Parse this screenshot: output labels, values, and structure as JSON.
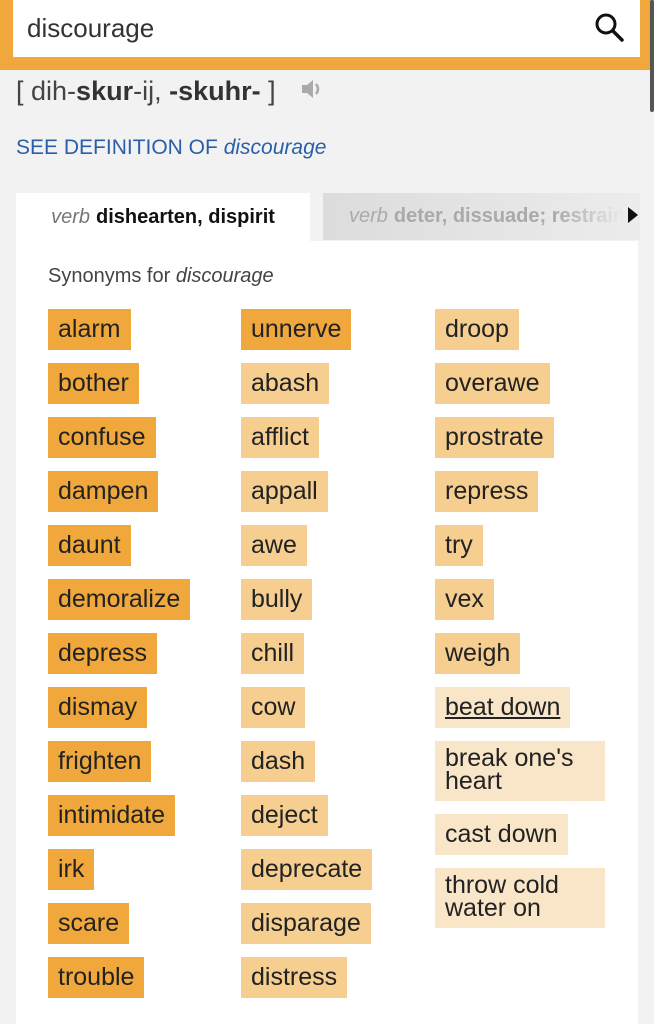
{
  "search": {
    "value": "discourage",
    "icon": "search-icon"
  },
  "pronunciation": {
    "open": "[ ",
    "p1": "dih-",
    "p2": "skur",
    "p3": "-ij, ",
    "p4": "-skuhr-",
    "close": " ]",
    "icon": "speaker-icon"
  },
  "see_definition": {
    "prefix": "SEE DEFINITION OF ",
    "word": "discourage"
  },
  "tabs": [
    {
      "pos": "verb",
      "label": "dishearten, dispirit",
      "active": true
    },
    {
      "pos": "verb",
      "label": "deter, dissuade; restrain",
      "active": false
    }
  ],
  "synonyms_label": {
    "prefix": "Synonyms for ",
    "word": "discourage"
  },
  "colors": {
    "relevance_high": "#f0a83c",
    "relevance_mid": "#f5ce90",
    "relevance_low": "#f9e5c8",
    "link": "#2a5fa8",
    "accent": "#f0a83c"
  },
  "columns": [
    [
      {
        "word": "alarm",
        "rel": 1
      },
      {
        "word": "bother",
        "rel": 1
      },
      {
        "word": "confuse",
        "rel": 1
      },
      {
        "word": "dampen",
        "rel": 1
      },
      {
        "word": "daunt",
        "rel": 1
      },
      {
        "word": "demoralize",
        "rel": 1
      },
      {
        "word": "depress",
        "rel": 1
      },
      {
        "word": "dismay",
        "rel": 1
      },
      {
        "word": "frighten",
        "rel": 1
      },
      {
        "word": "intimidate",
        "rel": 1
      },
      {
        "word": "irk",
        "rel": 1
      },
      {
        "word": "scare",
        "rel": 1
      },
      {
        "word": "trouble",
        "rel": 1
      }
    ],
    [
      {
        "word": "unnerve",
        "rel": 1
      },
      {
        "word": "abash",
        "rel": 2
      },
      {
        "word": "afflict",
        "rel": 2
      },
      {
        "word": "appall",
        "rel": 2
      },
      {
        "word": "awe",
        "rel": 2
      },
      {
        "word": "bully",
        "rel": 2
      },
      {
        "word": "chill",
        "rel": 2
      },
      {
        "word": "cow",
        "rel": 2
      },
      {
        "word": "dash",
        "rel": 2
      },
      {
        "word": "deject",
        "rel": 2
      },
      {
        "word": "deprecate",
        "rel": 2
      },
      {
        "word": "disparage",
        "rel": 2
      },
      {
        "word": "distress",
        "rel": 2
      }
    ],
    [
      {
        "word": "droop",
        "rel": 2
      },
      {
        "word": "overawe",
        "rel": 2
      },
      {
        "word": "prostrate",
        "rel": 2
      },
      {
        "word": "repress",
        "rel": 2
      },
      {
        "word": "try",
        "rel": 2
      },
      {
        "word": "vex",
        "rel": 2
      },
      {
        "word": "weigh",
        "rel": 2
      },
      {
        "word": "beat down",
        "rel": 3,
        "underline": true
      },
      {
        "word": "break one's heart",
        "rel": 3,
        "wrap": true
      },
      {
        "word": "cast down",
        "rel": 3
      },
      {
        "word": "throw cold water on",
        "rel": 3,
        "wrap": true
      }
    ]
  ]
}
